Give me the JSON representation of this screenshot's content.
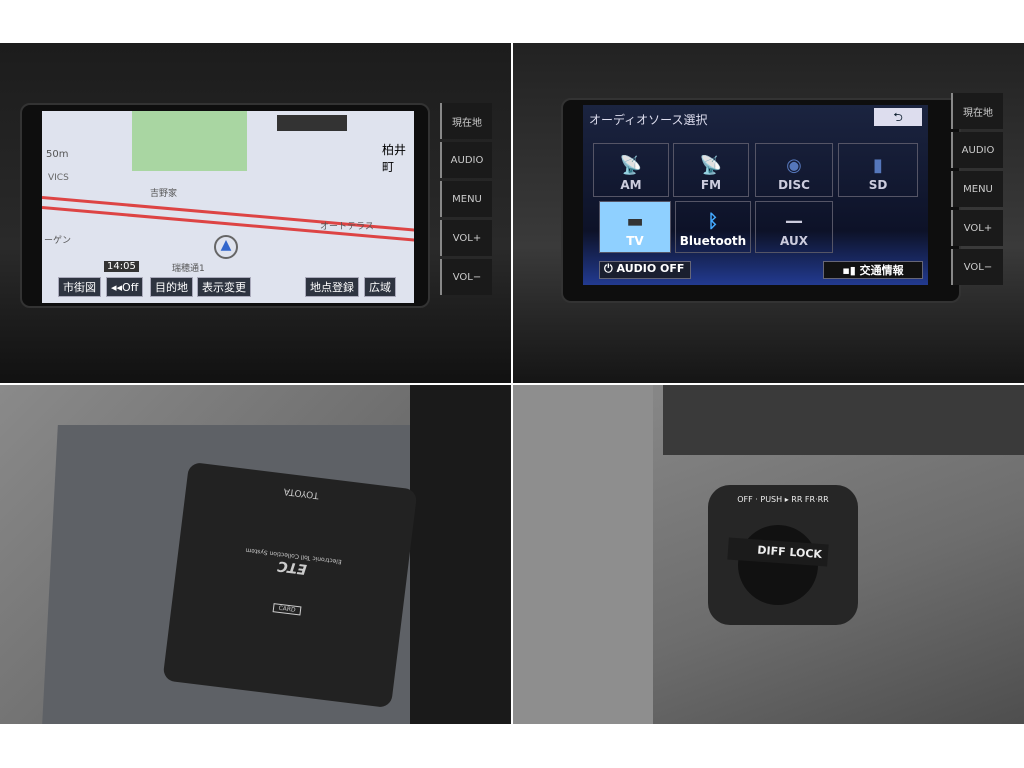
{
  "nav": {
    "scale": "50m",
    "vics": "VICS",
    "time": "14:05",
    "places": [
      "柏井町",
      "吉野家",
      "オートテラス",
      "ーゲン",
      "瑞穂通1"
    ],
    "buttons": [
      "市街図",
      "◂◂Off",
      "目的地",
      "表示変更",
      "地点登録",
      "広域"
    ],
    "side_buttons": [
      "現在地",
      "AUDIO",
      "MENU",
      "VOL+",
      "VOL−"
    ]
  },
  "audio": {
    "title": "オーディオソース選択",
    "back": "⮌",
    "sources": [
      {
        "label": "AM",
        "icon": "antenna-icon"
      },
      {
        "label": "FM",
        "icon": "antenna-icon"
      },
      {
        "label": "DISC",
        "icon": "disc-icon"
      },
      {
        "label": "SD",
        "icon": "sd-card-icon"
      },
      {
        "label": "TV",
        "icon": "tv-icon"
      },
      {
        "label": "Bluetooth",
        "icon": "bluetooth-icon"
      },
      {
        "label": "AUX",
        "icon": "aux-icon"
      }
    ],
    "audio_off": "⏻ AUDIO OFF",
    "traffic": "交通情報",
    "side_buttons": [
      "現在地",
      "AUDIO",
      "MENU",
      "VOL+",
      "VOL−"
    ],
    "accent": "#8fd0ff"
  },
  "etc": {
    "brand": "TOYOTA",
    "logo": "ETC",
    "subtitle": "Electronic Toll Collection System",
    "card": "CARD"
  },
  "diff": {
    "label": "DIFF LOCK",
    "ring": "OFF · PUSH ▸ RR   FR·RR"
  }
}
